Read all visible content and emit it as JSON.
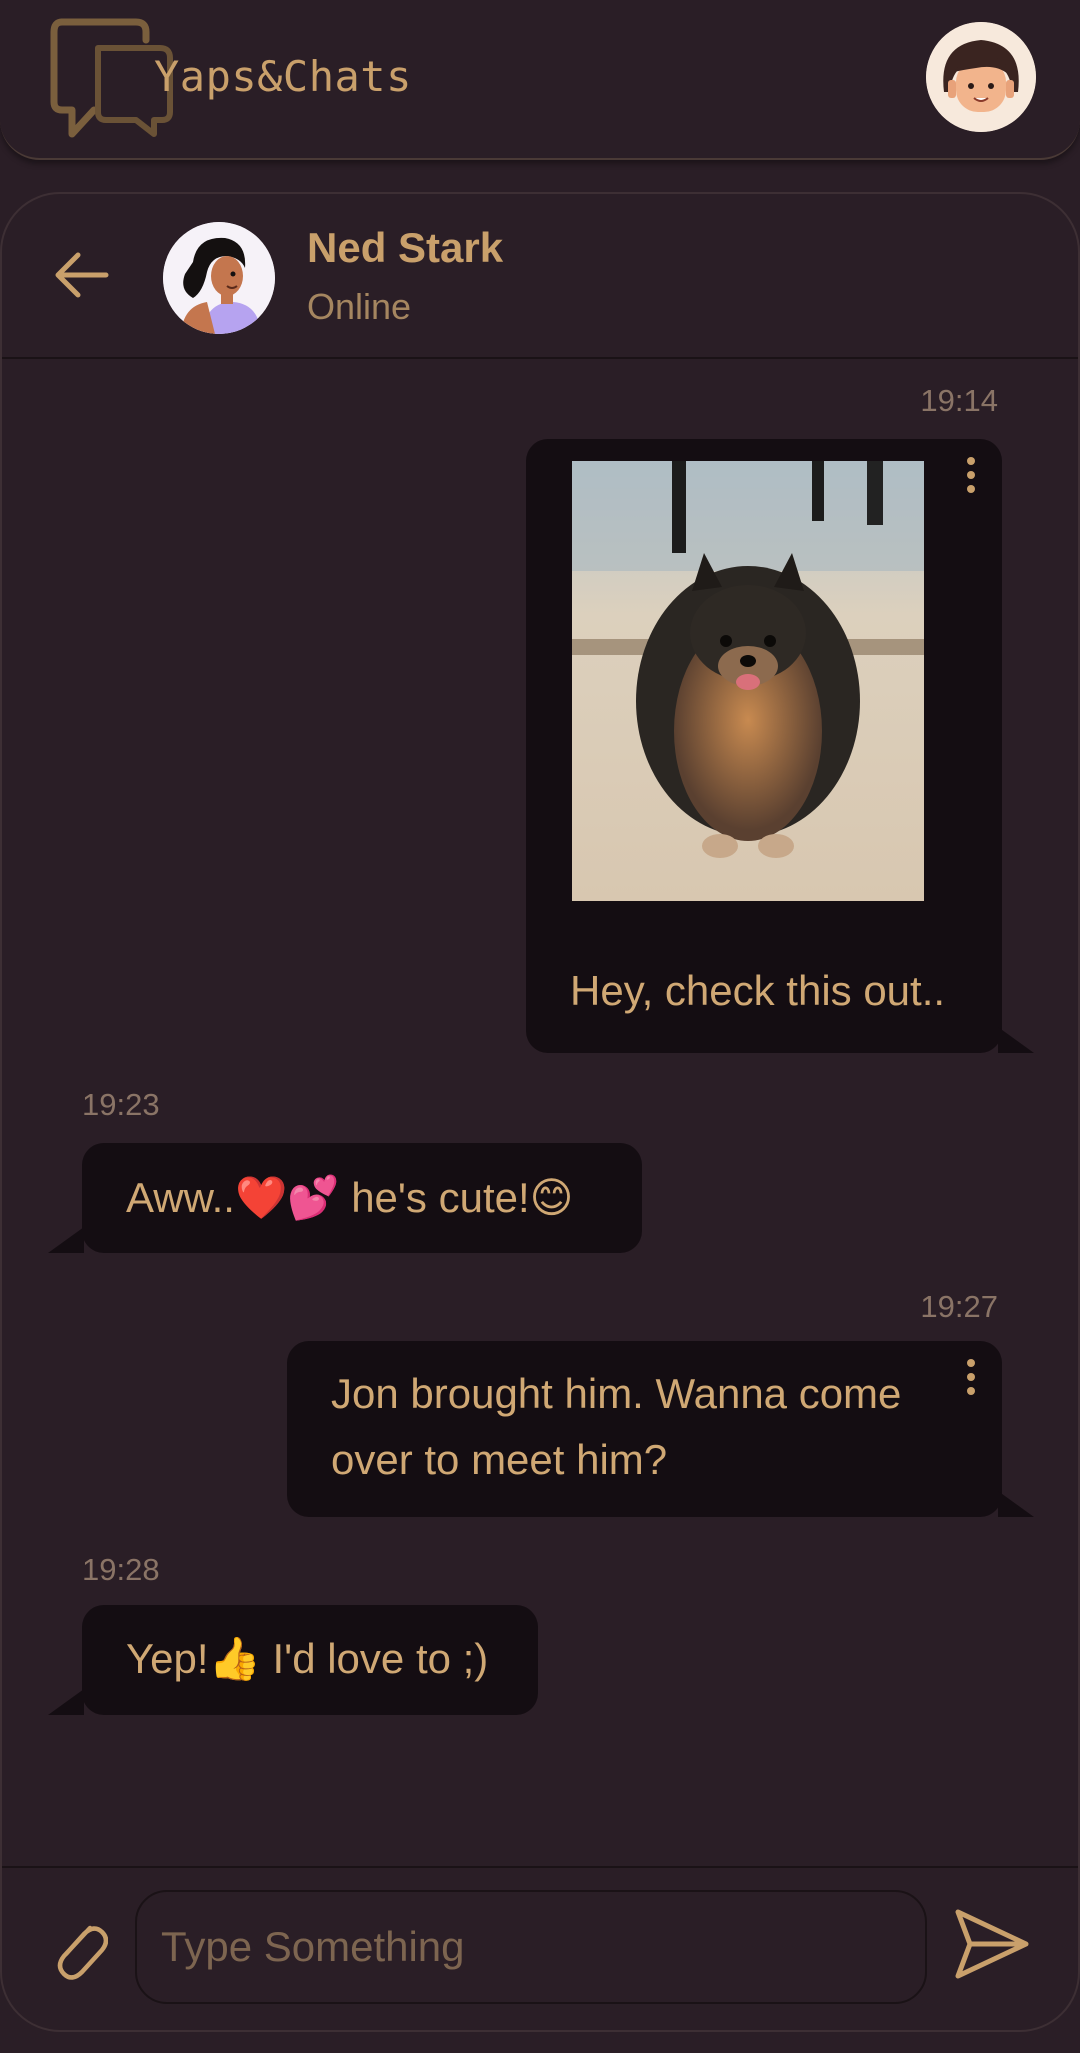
{
  "app": {
    "brand": "Yaps&Chats"
  },
  "chat": {
    "contact_name": "Ned Stark",
    "contact_status": "Online"
  },
  "messages": [
    {
      "direction": "outgoing",
      "time": "19:14",
      "type": "image",
      "caption": "Hey, check this out.."
    },
    {
      "direction": "incoming",
      "time": "19:23",
      "type": "text",
      "text": "Aww..❤️💕 he's cute!😊"
    },
    {
      "direction": "outgoing",
      "time": "19:27",
      "type": "text",
      "text": "Jon brought him. Wanna come over to meet him?"
    },
    {
      "direction": "incoming",
      "time": "19:28",
      "type": "text",
      "text": "Yep!👍 I'd love to ;)"
    }
  ],
  "composer": {
    "placeholder": "Type Something"
  },
  "icons": {
    "logo": "chat-bubbles-icon",
    "back": "arrow-left-icon",
    "more": "kebab-menu-icon",
    "attach": "paperclip-icon",
    "send": "send-icon"
  },
  "colors": {
    "background": "#2a1e26",
    "bubble": "#140d12",
    "accent": "#c9a06b",
    "muted": "#8a7466"
  }
}
